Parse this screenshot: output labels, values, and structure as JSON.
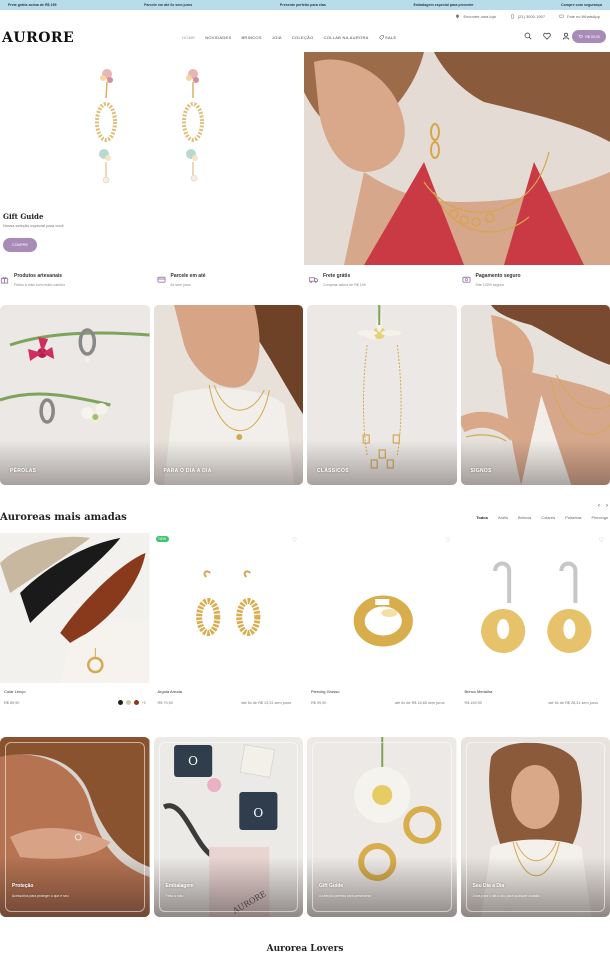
{
  "topbar": {
    "messages": [
      "Frete grátis acima de R$ 199",
      "Parcele em até 6x sem juros",
      "Presente perfeito para elas",
      "Embalagem especial para presente",
      "Compre com segurança"
    ]
  },
  "header": {
    "logo": "AURORE",
    "utility": {
      "stores": "Encontre uma loja",
      "phone": "(21) 3000-1907",
      "whatsapp": "Fale no WhatsApp"
    },
    "nav": [
      {
        "label": "HOME",
        "active": true
      },
      {
        "label": "NOVIDADES",
        "active": false
      },
      {
        "label": "BRINCOS",
        "active": false
      },
      {
        "label": "JOIA",
        "active": false
      },
      {
        "label": "COLEÇÃO",
        "active": false
      },
      {
        "label": "COLLAB NA AURORA",
        "active": false
      },
      {
        "label": "SALE",
        "active": false
      }
    ],
    "cart_label": "R$ 00,00",
    "accent_color": "#a98bb8"
  },
  "hero": {
    "title": "Gift Guide",
    "subtitle": "Nossa seleção especial para você",
    "button_label": "COMPRE"
  },
  "benefits": [
    {
      "icon": "gift-icon",
      "title": "Produtos artesanais",
      "subtitle": "Feitos à mão com muito carinho"
    },
    {
      "icon": "card-icon",
      "title": "Parcele em até",
      "subtitle": "6x sem juros"
    },
    {
      "icon": "truck-icon",
      "title": "Frete grátis",
      "subtitle": "Compras acima de R$ 199"
    },
    {
      "icon": "shield-icon",
      "title": "Pagamento seguro",
      "subtitle": "Site 100% seguro"
    }
  ],
  "categories": [
    {
      "label": "PÉROLAS"
    },
    {
      "label": "PARA O DIA A DIA"
    },
    {
      "label": "CLÁSSICOS"
    },
    {
      "label": "SIGNOS"
    }
  ],
  "bestsellers": {
    "title": "Auroreas mais amadas",
    "filters": [
      {
        "label": "Todos",
        "active": true
      },
      {
        "label": "Anéis",
        "active": false
      },
      {
        "label": "Brincos",
        "active": false
      },
      {
        "label": "Colares",
        "active": false
      },
      {
        "label": "Pulseiras",
        "active": false
      },
      {
        "label": "Piercings",
        "active": false
      }
    ],
    "products": [
      {
        "name": "Colar Lenço",
        "price": "R$ 89,90",
        "installment": "",
        "badge": "",
        "swatch_more": "+3"
      },
      {
        "name": "Argola Arruda",
        "price": "R$ 79,90",
        "installment": "até 6x de R$ 13,31 sem juros",
        "badge": "NEW",
        "swatch_more": ""
      },
      {
        "name": "Piercing Grosso",
        "price": "R$ 99,90",
        "installment": "até 6x de R$ 16,65 sem juros",
        "badge": "",
        "swatch_more": ""
      },
      {
        "name": "Brinco Medalha",
        "price": "R$ 169,90",
        "installment": "até 6x de R$ 28,31 sem juros",
        "badge": "",
        "swatch_more": ""
      }
    ]
  },
  "editorial": [
    {
      "title": "Proteção",
      "subtitle": "Acessórios para proteger o que é seu"
    },
    {
      "title": "Embalagem",
      "subtitle": "Feita à mão"
    },
    {
      "title": "Gift Guide",
      "subtitle": "A seleção perfeita para presentear"
    },
    {
      "title": "Seu Dia a Dia",
      "subtitle": "Joias para o dia a dia, para qualquer ocasião"
    }
  ],
  "lovers_title": "Aurorea Lovers"
}
